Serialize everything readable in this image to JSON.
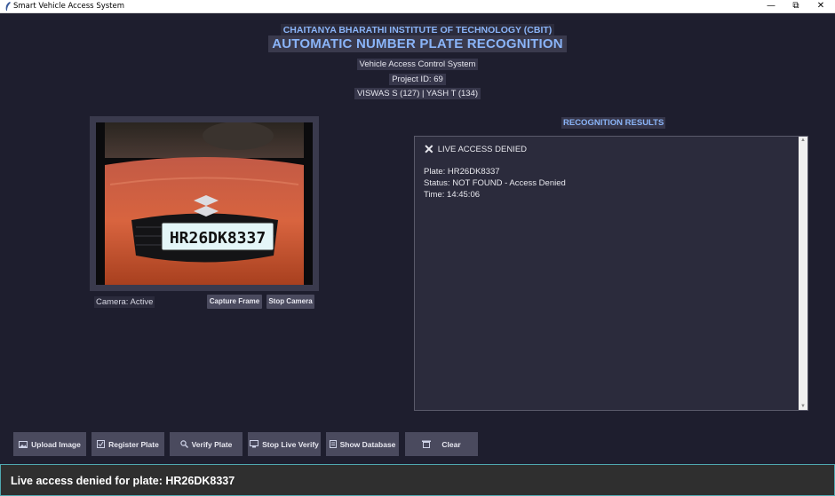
{
  "window": {
    "title": "Smart Vehicle Access System",
    "minimize_icon": "—",
    "restore_icon": "⧉",
    "close_icon": "✕"
  },
  "header": {
    "college": "CHAITANYA BHARATHI INSTITUTE OF TECHNOLOGY (CBIT)",
    "title": "AUTOMATIC NUMBER PLATE RECOGNITION",
    "subtitle": "Vehicle Access Control System",
    "project_id": "Project ID: 69",
    "team": "VISWAS S (127) | YASH T (134)"
  },
  "camera": {
    "plate_text": "HR26DK8337",
    "status": "Camera: Active",
    "capture_label": "Capture Frame",
    "stop_label": "Stop Camera"
  },
  "results": {
    "title": "RECOGNITION RESULTS",
    "icon": "✕",
    "heading": "LIVE ACCESS DENIED",
    "plate_line": "Plate: HR26DK8337",
    "status_line": "Status: NOT FOUND - Access Denied",
    "time_line": "Time: 14:45:06"
  },
  "buttons": {
    "upload": {
      "label": "Upload Image",
      "icon": "image-icon"
    },
    "register": {
      "label": "Register Plate",
      "icon": "checkbox-icon"
    },
    "verify": {
      "label": "Verify Plate",
      "icon": "magnifier-icon"
    },
    "stop_live": {
      "label": "Stop Live Verify",
      "icon": "monitor-icon"
    },
    "show_db": {
      "label": "Show Database",
      "icon": "database-icon"
    },
    "clear": {
      "label": "Clear",
      "icon": "trash-icon"
    }
  },
  "status_bar": {
    "message": "Live access denied for plate: HR26DK8337"
  },
  "colors": {
    "background": "#1e1e2e",
    "accent": "#8ab4f8",
    "button": "#4a4a5e",
    "status_border": "#4fa8b0"
  }
}
